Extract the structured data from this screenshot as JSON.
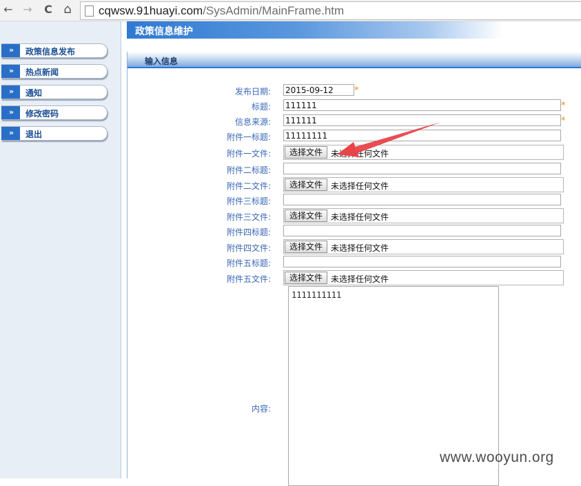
{
  "browser": {
    "back": "←",
    "forward": "→",
    "reload": "C",
    "home": "⌂",
    "url_host": "cqwsw.91huayi.com",
    "url_path": "/SysAdmin/MainFrame.htm"
  },
  "sidebar": {
    "items": [
      {
        "label": "政策信息发布"
      },
      {
        "label": "热点新闻"
      },
      {
        "label": "通知"
      },
      {
        "label": "修改密码"
      },
      {
        "label": "退出"
      }
    ],
    "icon_glyph": "»"
  },
  "header": {
    "title": "政策信息维护"
  },
  "panel": {
    "title": "输入信息"
  },
  "form": {
    "publish_date": {
      "label": "发布日期:",
      "value": "2015-09-12",
      "required": "*"
    },
    "title": {
      "label": "标题:",
      "value": "111111",
      "required": "*"
    },
    "source": {
      "label": "信息来源:",
      "value": "111111",
      "required": "*"
    },
    "attachments": [
      {
        "title_label": "附件一标题:",
        "title_value": "11111111",
        "file_label": "附件一文件:"
      },
      {
        "title_label": "附件二标题:",
        "title_value": "",
        "file_label": "附件二文件:"
      },
      {
        "title_label": "附件三标题:",
        "title_value": "",
        "file_label": "附件三文件:"
      },
      {
        "title_label": "附件四标题:",
        "title_value": "",
        "file_label": "附件四文件:"
      },
      {
        "title_label": "附件五标题:",
        "title_value": "",
        "file_label": "附件五文件:"
      }
    ],
    "file_button_label": "选择文件",
    "file_status": "未选择任何文件",
    "content": {
      "label": "内容:",
      "value": "1111111111"
    }
  },
  "watermark": "www.wooyun.org",
  "colors": {
    "accent": "#2f74cf",
    "label": "#3967b8",
    "required": "#ef8c17",
    "annotation_arrow": "#e8454a"
  }
}
